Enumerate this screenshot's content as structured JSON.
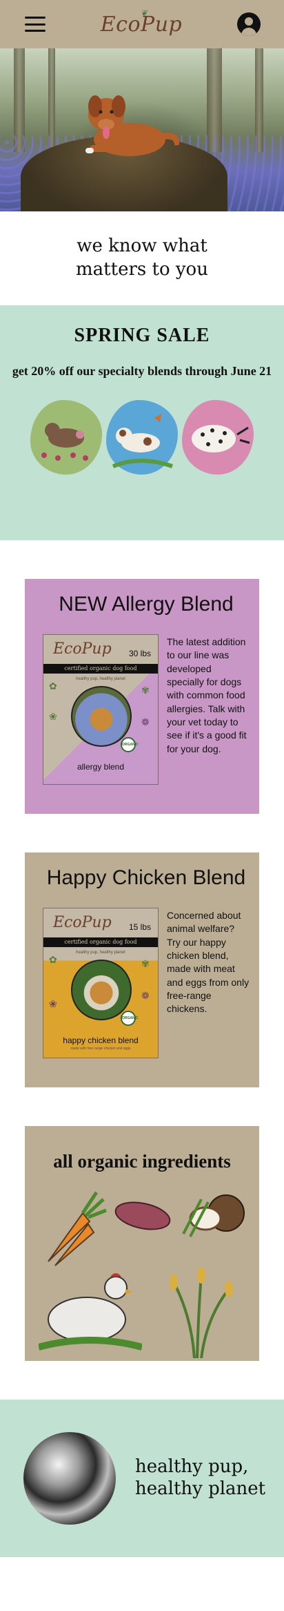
{
  "header": {
    "menu_icon": "hamburger-menu-icon",
    "logo_text": "EcoPup",
    "account_icon": "account-circle-icon",
    "background_color": "#bcae94"
  },
  "hero": {
    "image_description_icon": "dog-photo"
  },
  "tagline": {
    "text": "we know what matters to you"
  },
  "sale": {
    "title": "SPRING SALE",
    "subtitle": "get 20% off our specialty blends through June 21",
    "background_color": "#c1e1d3"
  },
  "products": [
    {
      "title": "NEW  Allergy Blend",
      "bag_brand": "EcoPup",
      "bag_weight": "30 lbs",
      "bag_strip": "certified organic dog food",
      "bag_sub": "healthy pup, healthy planet",
      "bag_name": "allergy blend",
      "seal": "ORGANIC",
      "description": "The latest addition to our line was developed specially for dogs with common food allergies. Talk with your vet today to see if it's a good fit for your dog.",
      "background_color": "#c897c6"
    },
    {
      "title": "Happy Chicken Blend",
      "bag_brand": "EcoPup",
      "bag_weight": "15 lbs",
      "bag_strip": "certified organic dog food",
      "bag_sub": "healthy pup, healthy planet",
      "bag_name": "happy chicken blend",
      "bag_tiny": "made with free range chicken and eggs",
      "seal": "ORGANIC",
      "description": "Concerned about animal welfare? Try our happy chicken blend, made with meat and eggs from only free-range chickens.",
      "background_color": "#bcae94"
    }
  ],
  "organic": {
    "title": "all organic ingredients"
  },
  "planet": {
    "text": "healthy pup, healthy planet",
    "background_color": "#c1e1d3"
  }
}
